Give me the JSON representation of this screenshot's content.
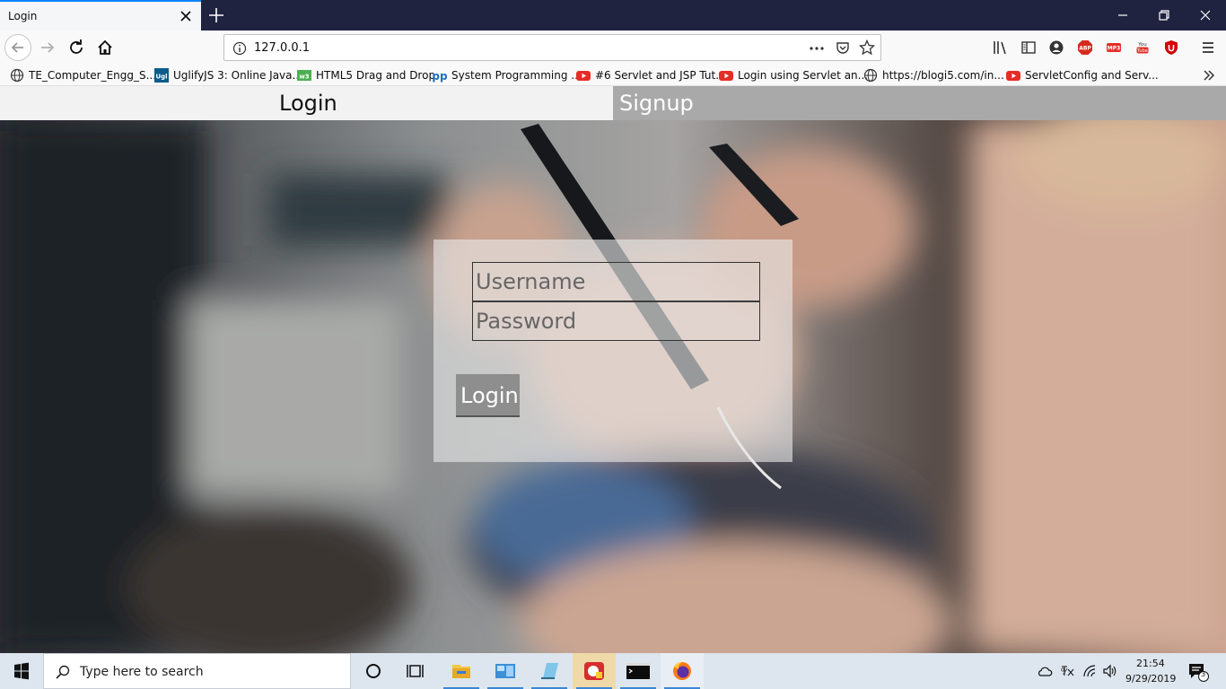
{
  "browser": {
    "tab_title": "Login",
    "url": "127.0.0.1",
    "accent_color": "#0a84ff",
    "bookmarks": [
      {
        "label": "TE_Computer_Engg_S...",
        "icon": "globe-icon"
      },
      {
        "label": "UglifyJS 3: Online Java...",
        "icon": "uglify-icon"
      },
      {
        "label": "HTML5 Drag and Drop",
        "icon": "w3-icon"
      },
      {
        "label": "System Programming ...",
        "icon": "pp-icon"
      },
      {
        "label": "#6 Servlet and JSP Tut...",
        "icon": "youtube-icon"
      },
      {
        "label": "Login using Servlet an...",
        "icon": "youtube-icon"
      },
      {
        "label": "https://blogi5.com/in...",
        "icon": "globe-icon"
      },
      {
        "label": "ServletConfig and Serv...",
        "icon": "youtube-icon"
      }
    ]
  },
  "site_nav": {
    "login_label": "Login",
    "signup_label": "Signup"
  },
  "login_form": {
    "username_placeholder": "Username",
    "password_placeholder": "Password",
    "submit_label": "Login"
  },
  "taskbar": {
    "search_placeholder": "Type here to search",
    "time": "21:54",
    "date": "9/29/2019",
    "notification_count": "3"
  }
}
